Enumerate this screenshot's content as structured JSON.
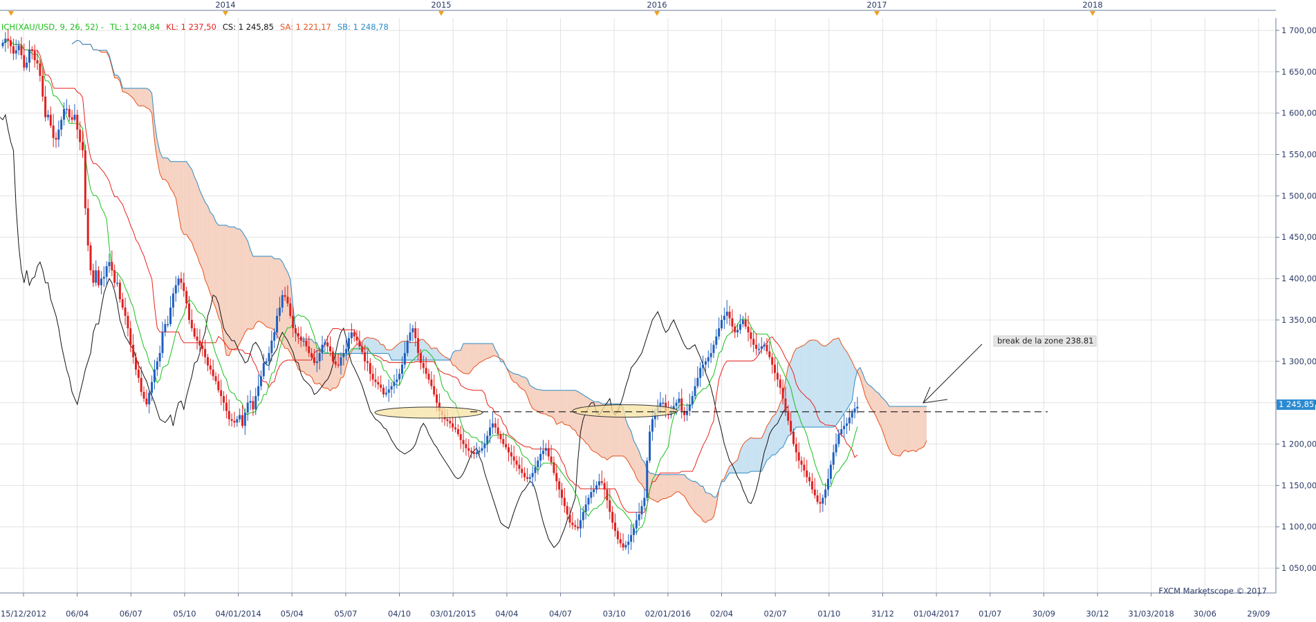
{
  "chart_data": {
    "type": "candlestick",
    "instrument": "XAU/USD",
    "legend": [
      {
        "key": "ich",
        "text": "ICH(XAU/USD, 9, 26, 52)  -",
        "color": "#19c019"
      },
      {
        "key": "tl",
        "text": "TL: 1 204,84",
        "color": "#19c019"
      },
      {
        "key": "kl",
        "text": "KL: 1 237,50",
        "color": "#e8201a"
      },
      {
        "key": "cs",
        "text": "CS: 1 245,85",
        "color": "#111111"
      },
      {
        "key": "sa",
        "text": "SA: 1 221,17",
        "color": "#e8501a"
      },
      {
        "key": "sb",
        "text": "SB: 1 248,78",
        "color": "#2a8ac4"
      }
    ],
    "years": [
      "2014",
      "2015",
      "2016",
      "2017",
      "2018"
    ],
    "x_ticks": [
      "15/12/2012",
      "06/04",
      "06/07",
      "05/10",
      "04/01/2014",
      "05/04",
      "05/07",
      "04/10",
      "03/01/2015",
      "04/04",
      "04/07",
      "03/10",
      "02/01/2016",
      "02/04",
      "02/07",
      "01/10",
      "31/12",
      "01/04/2017",
      "01/07",
      "30/09",
      "30/12",
      "31/03/2018",
      "30/06",
      "29/09"
    ],
    "y_ticks": [
      1050,
      1100,
      1150,
      1200,
      1250,
      1300,
      1350,
      1400,
      1450,
      1500,
      1550,
      1600,
      1650,
      1700
    ],
    "y_tick_labels": [
      "1 050,00",
      "1 100,00",
      "1 150,00",
      "1 200,00",
      "1 250,00",
      "1 300,00",
      "1 350,00",
      "1 400,00",
      "1 450,00",
      "1 500,00",
      "1 550,00",
      "1 600,00",
      "1 650,00",
      "1 700,00"
    ],
    "ylim": [
      1020,
      1715
    ],
    "current_price": 1245.85,
    "current_price_label": "1 245,85",
    "series": {
      "close": [
        1685,
        1690,
        1688,
        1681,
        1672,
        1676,
        1682,
        1670,
        1655,
        1661,
        1677,
        1675,
        1664,
        1660,
        1645,
        1620,
        1595,
        1598,
        1585,
        1570,
        1568,
        1580,
        1592,
        1605,
        1605,
        1595,
        1592,
        1598,
        1580,
        1565,
        1555,
        1485,
        1440,
        1410,
        1395,
        1410,
        1392,
        1400,
        1402,
        1415,
        1420,
        1410,
        1395,
        1395,
        1375,
        1365,
        1355,
        1340,
        1320,
        1305,
        1290,
        1280,
        1263,
        1255,
        1248,
        1262,
        1275,
        1290,
        1300,
        1310,
        1335,
        1345,
        1345,
        1365,
        1382,
        1392,
        1400,
        1395,
        1385,
        1370,
        1350,
        1340,
        1330,
        1325,
        1319,
        1315,
        1305,
        1295,
        1290,
        1282,
        1276,
        1265,
        1258,
        1250,
        1240,
        1230,
        1228,
        1226,
        1230,
        1235,
        1222,
        1238,
        1250,
        1252,
        1242,
        1258,
        1270,
        1282,
        1298,
        1300,
        1310,
        1325,
        1335,
        1355,
        1365,
        1380,
        1378,
        1370,
        1355,
        1340,
        1334,
        1330,
        1325,
        1325,
        1318,
        1310,
        1305,
        1298,
        1300,
        1310,
        1320,
        1323,
        1318,
        1312,
        1300,
        1296,
        1295,
        1305,
        1310,
        1315,
        1328,
        1335,
        1330,
        1325,
        1318,
        1311,
        1300,
        1298,
        1285,
        1278,
        1275,
        1272,
        1268,
        1260,
        1262,
        1266,
        1270,
        1275,
        1278,
        1285,
        1296,
        1310,
        1325,
        1335,
        1340,
        1328,
        1310,
        1298,
        1292,
        1285,
        1278,
        1270,
        1260,
        1250,
        1240,
        1235,
        1230,
        1228,
        1225,
        1220,
        1218,
        1212,
        1205,
        1200,
        1195,
        1192,
        1190,
        1188,
        1190,
        1192,
        1195,
        1200,
        1210,
        1220,
        1225,
        1220,
        1212,
        1206,
        1200,
        1196,
        1190,
        1185,
        1180,
        1175,
        1170,
        1165,
        1160,
        1158,
        1160,
        1165,
        1172,
        1180,
        1188,
        1192,
        1195,
        1185,
        1178,
        1165,
        1155,
        1145,
        1135,
        1125,
        1115,
        1105,
        1102,
        1100,
        1098,
        1108,
        1118,
        1127,
        1135,
        1142,
        1145,
        1150,
        1155,
        1153,
        1145,
        1132,
        1118,
        1105,
        1095,
        1085,
        1080,
        1075,
        1078,
        1082,
        1090,
        1098,
        1108,
        1115,
        1125,
        1135,
        1180,
        1215,
        1230,
        1238,
        1245,
        1250,
        1250,
        1238,
        1235,
        1240,
        1246,
        1250,
        1255,
        1240,
        1235,
        1240,
        1248,
        1258,
        1270,
        1280,
        1292,
        1296,
        1300,
        1305,
        1310,
        1320,
        1330,
        1340,
        1350,
        1355,
        1360,
        1352,
        1342,
        1335,
        1338,
        1345,
        1350,
        1342,
        1335,
        1327,
        1320,
        1315,
        1315,
        1318,
        1320,
        1312,
        1305,
        1296,
        1286,
        1278,
        1268,
        1255,
        1240,
        1228,
        1215,
        1200,
        1190,
        1180,
        1175,
        1168,
        1160,
        1155,
        1145,
        1138,
        1130,
        1128,
        1135,
        1145,
        1158,
        1175,
        1190,
        1200,
        1212,
        1218,
        1222,
        1225,
        1232,
        1238,
        1243,
        1245
      ]
    },
    "annotation": {
      "text": "break de la zone 238.81"
    },
    "credit": "FXCM Marketscope © 2017"
  }
}
